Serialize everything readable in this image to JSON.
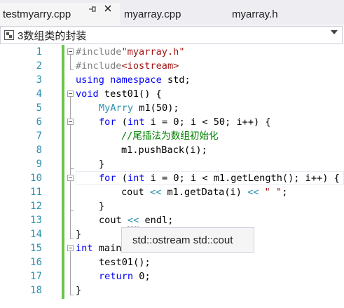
{
  "tabs": [
    {
      "label": "testmyarry.cpp",
      "active": true
    },
    {
      "label": "myarray.cpp",
      "active": false
    },
    {
      "label": "myarray.h",
      "active": false
    }
  ],
  "tab_icons": {
    "pin": "pin-icon",
    "close": "close-icon"
  },
  "navbar": {
    "scope": "3数组类的封装",
    "icon": "scope-icon"
  },
  "line_numbers": [
    "1",
    "2",
    "3",
    "4",
    "5",
    "6",
    "7",
    "8",
    "9",
    "10",
    "11",
    "12",
    "13",
    "14",
    "15",
    "16",
    "17",
    "18"
  ],
  "code": {
    "l1_pp": "#include",
    "l1_str": "\"myarray.h\"",
    "l2_pp": "#include",
    "l2_str": "<iostream>",
    "l3_kw": "using namespace",
    "l3_rest": " std;",
    "l4_kw": "void",
    "l4_rest": " test01() {",
    "l5_ty": "MyArry",
    "l5_rest": " m1(50);",
    "l6_kw1": "for",
    "l6_a": " (",
    "l6_kw2": "int",
    "l6_b": " i = 0; i < 50; i++) {",
    "l7_cm": "//尾插法为数组初始化",
    "l8": "m1.pushBack(i);",
    "l9": "}",
    "l10_kw1": "for",
    "l10_a": " (",
    "l10_kw2": "int",
    "l10_b": " i = 0; i < m1.getLength(); i++) {",
    "l11_a": "cout ",
    "l11_op1": "<<",
    "l11_b": " m1.getData(i) ",
    "l11_op2": "<<",
    "l11_sp": " ",
    "l11_str": "\" \"",
    "l11_end": ";",
    "l12": "}",
    "l13_a": "cout ",
    "l13_op": "<<",
    "l13_b": " endl;",
    "l14": "}",
    "l15_kw": "int",
    "l15_rest": " main()",
    "l16": "test01();",
    "l17_kw": "return",
    "l17_rest": " 0;",
    "l18": "}"
  },
  "tooltip": {
    "text": "std::ostream std::cout"
  },
  "colors": {
    "accent_change": "#6cc24a",
    "keyword": "#0000ff",
    "string": "#a31515",
    "type": "#2b91af",
    "comment": "#008000"
  }
}
